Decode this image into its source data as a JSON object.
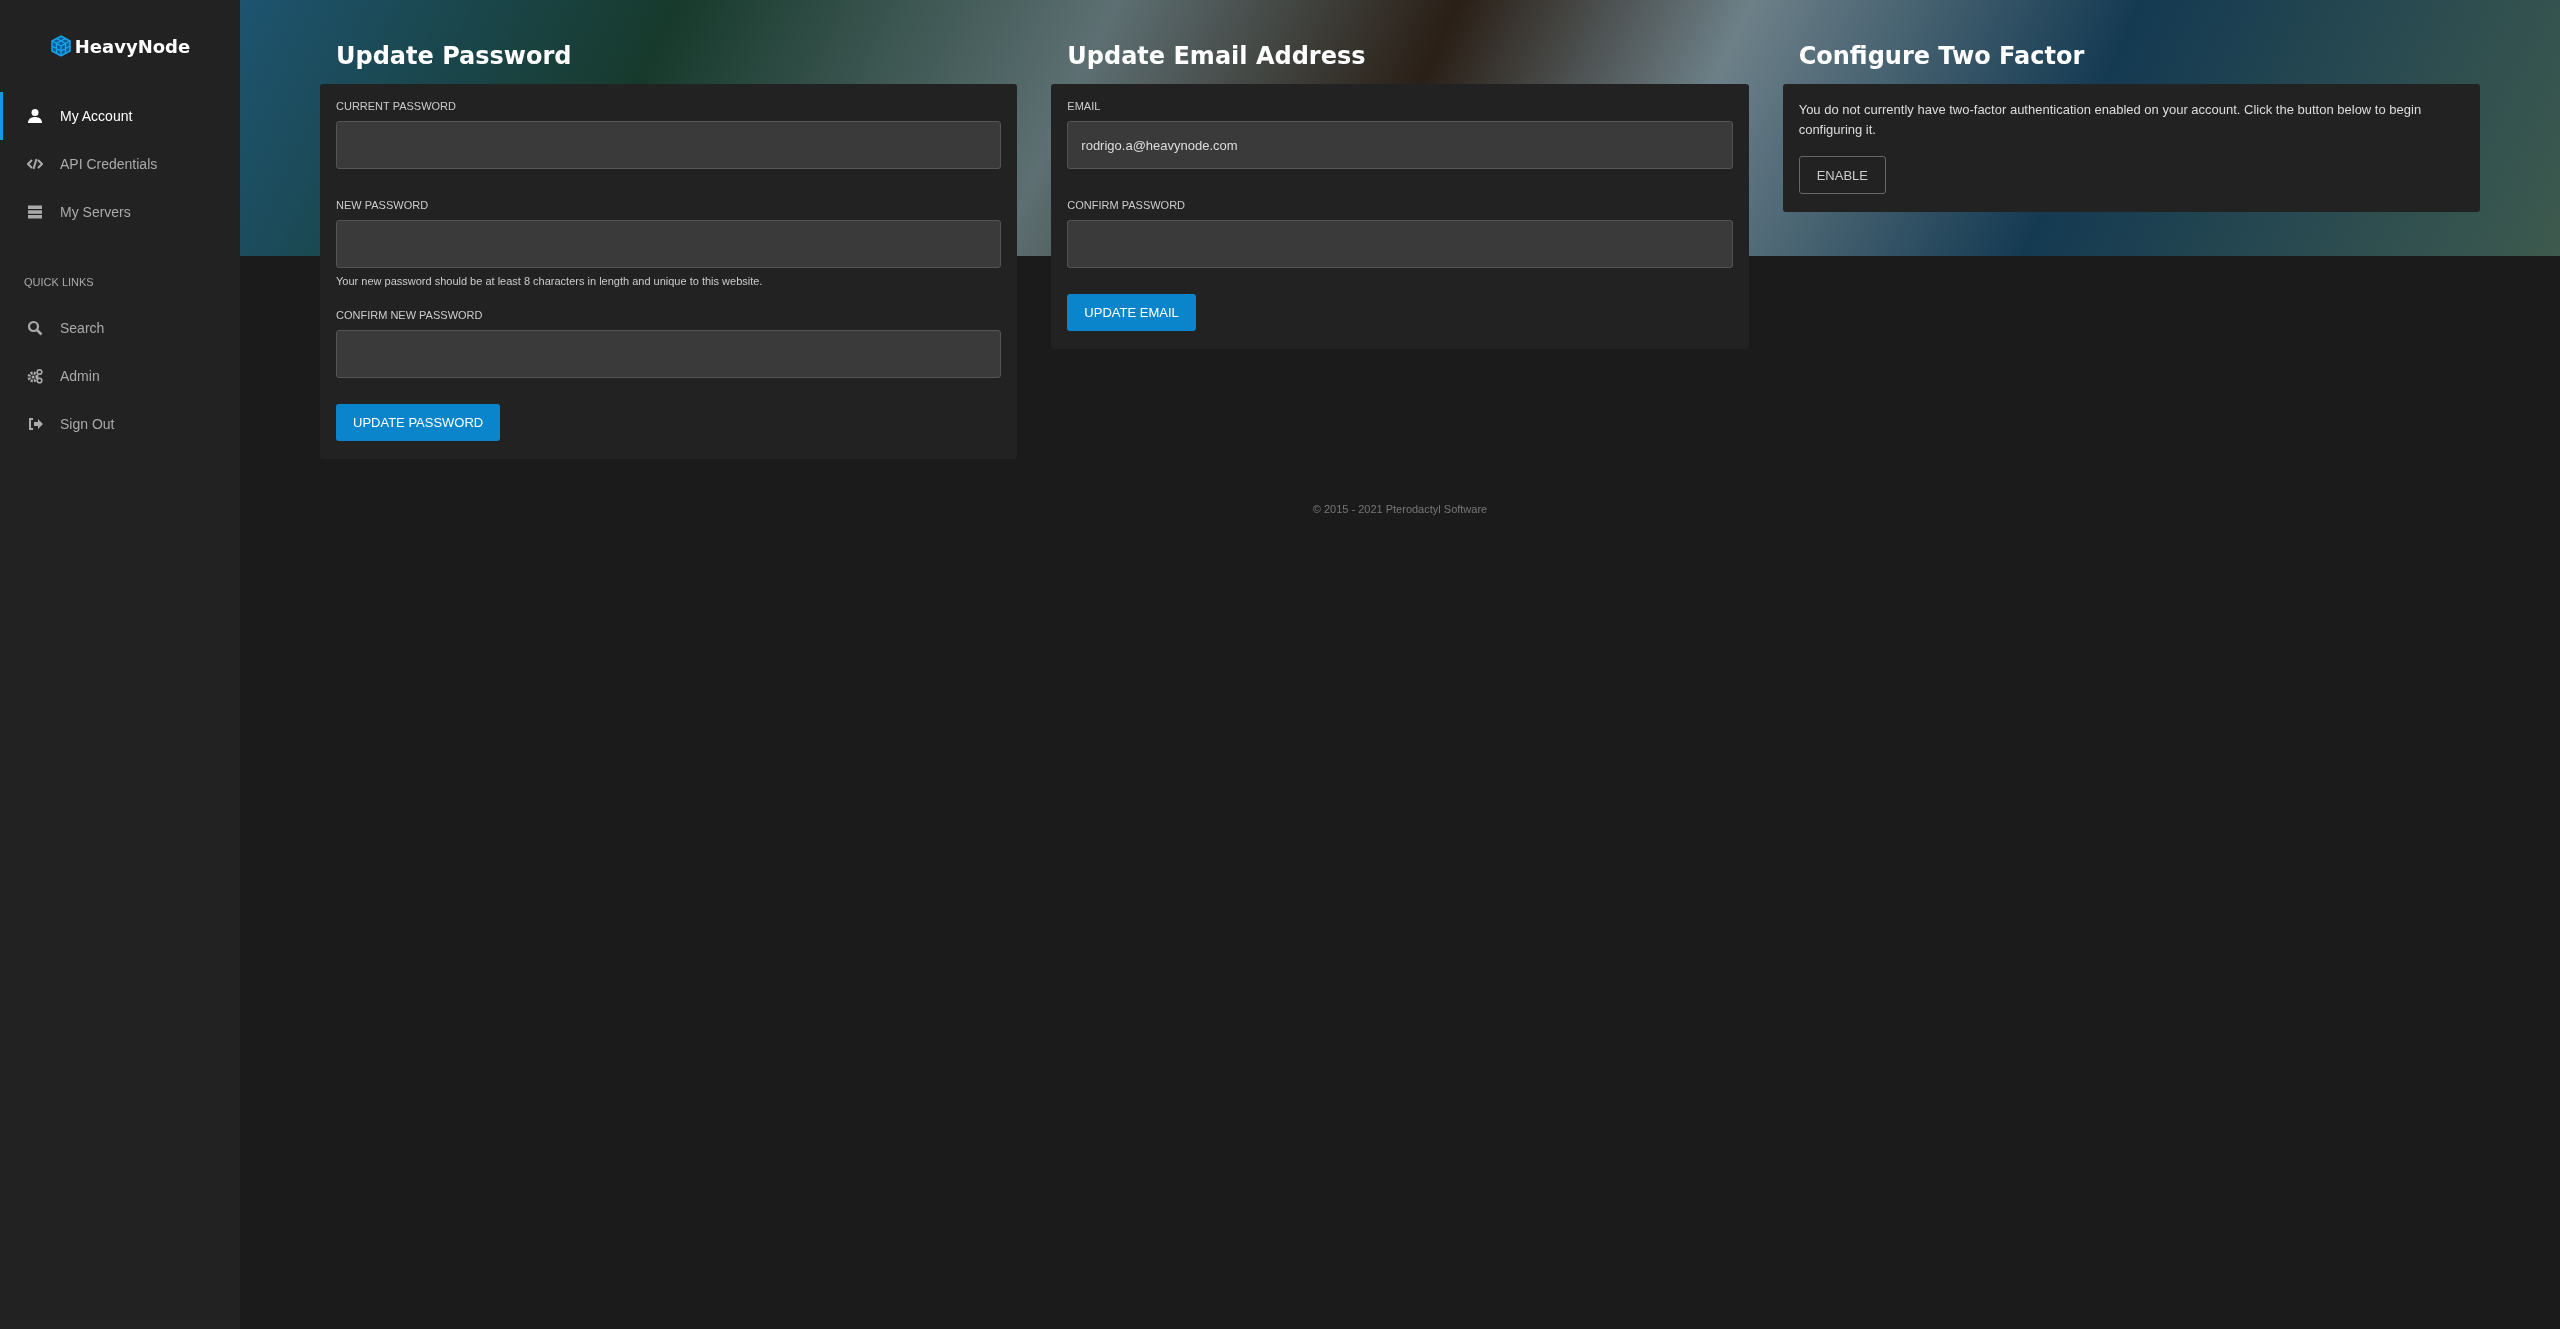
{
  "sidebar": {
    "brand": "HeavyNode",
    "nav": [
      {
        "label": "My Account",
        "selected": true
      },
      {
        "label": "API Credentials",
        "selected": false
      },
      {
        "label": "My Servers",
        "selected": false
      }
    ],
    "section_label": "QUICK LINKS",
    "quick_links": [
      {
        "label": "Search"
      },
      {
        "label": "Admin"
      },
      {
        "label": "Sign Out"
      }
    ]
  },
  "sections": [
    {
      "kind": "form",
      "title": "Update Password",
      "fields": [
        {
          "label": "CURRENT PASSWORD"
        },
        {
          "label": "NEW PASSWORD",
          "help": "Your new password should be at least 8 characters in length and unique to this website."
        },
        {
          "label": "CONFIRM NEW PASSWORD"
        }
      ],
      "button": "UPDATE PASSWORD"
    },
    {
      "kind": "form",
      "title": "Update Email Address",
      "fields": [
        {
          "label": "EMAIL",
          "value": "rodrigo.a@heavynode.com"
        },
        {
          "label": "CONFIRM PASSWORD"
        }
      ],
      "button": "UPDATE EMAIL"
    },
    {
      "kind": "message",
      "title": "Configure Two Factor",
      "text": "You do not currently have two-factor authentication enabled on your account. Click the button below to begin configuring it.",
      "button": "ENABLE"
    }
  ],
  "footer": "© 2015 - 2021 Pterodactyl Software"
}
